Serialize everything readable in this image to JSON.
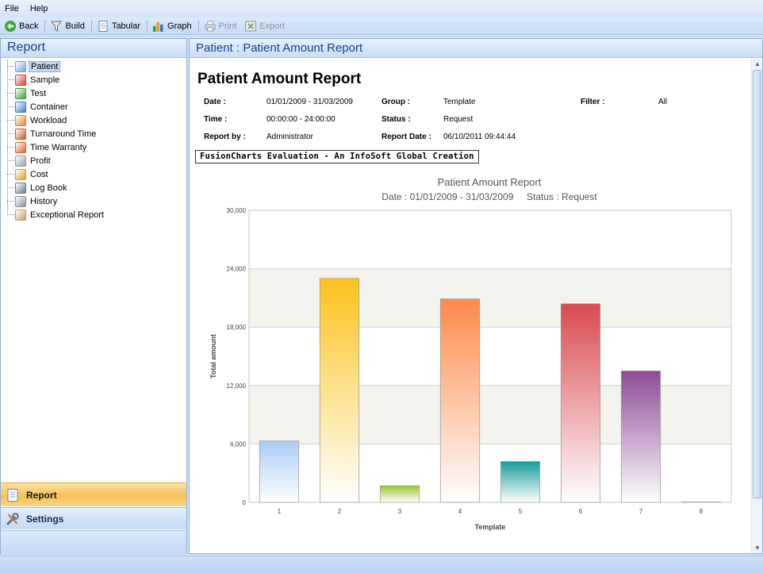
{
  "menubar": {
    "items": [
      "File",
      "Help"
    ]
  },
  "toolbar": {
    "back": "Back",
    "build": "Build",
    "tabular": "Tabular",
    "graph": "Graph",
    "print": "Print",
    "export": "Export"
  },
  "left_pane": {
    "title": "Report",
    "tree": [
      {
        "label": "Patient",
        "icon": "patient-icon",
        "color": "#6fa6d9"
      },
      {
        "label": "Sample",
        "icon": "sample-icon",
        "color": "#d14030"
      },
      {
        "label": "Test",
        "icon": "test-icon",
        "color": "#3aa03a"
      },
      {
        "label": "Container",
        "icon": "container-icon",
        "color": "#3d7fc8"
      },
      {
        "label": "Workload",
        "icon": "workload-icon",
        "color": "#d98b2b"
      },
      {
        "label": "Turnaround Time",
        "icon": "turnaround-clock-icon",
        "color": "#c85a2a"
      },
      {
        "label": "Time Warranty",
        "icon": "warranty-clock-icon",
        "color": "#e06030"
      },
      {
        "label": "Profit",
        "icon": "profit-icon",
        "color": "#9aa0a8"
      },
      {
        "label": "Cost",
        "icon": "cost-coins-icon",
        "color": "#d6a11e"
      },
      {
        "label": "Log Book",
        "icon": "log-book-icon",
        "color": "#6c7c8c"
      },
      {
        "label": "History",
        "icon": "history-icon",
        "color": "#8892a0"
      },
      {
        "label": "Exceptional Report",
        "icon": "exceptional-report-icon",
        "color": "#c0a060"
      }
    ],
    "nav": {
      "report": "Report",
      "settings": "Settings"
    }
  },
  "right_pane": {
    "title": "Patient : Patient Amount Report",
    "report_title": "Patient Amount Report",
    "meta": {
      "date_label": "Date :",
      "date_value": "01/01/2009 - 31/03/2009",
      "time_label": "Time :",
      "time_value": "00:00:00 - 24:00:00",
      "reportby_label": "Report by :",
      "reportby_value": "Administrator",
      "group_label": "Group :",
      "group_value": "Template",
      "status_label": "Status :",
      "status_value": "Request",
      "reportdate_label": "Report Date :",
      "reportdate_value": "06/10/2011 09:44:44",
      "filter_label": "Filter :",
      "filter_value": "All"
    },
    "banner": "FusionCharts Evaluation - An InfoSoft Global Creation"
  },
  "chart_data": {
    "type": "bar",
    "title": "Patient Amount Report",
    "subtitle": "Date : 01/01/2009 - 31/03/2009     Status : Request",
    "xlabel": "Template",
    "ylabel": "Total amount",
    "ylim": [
      0,
      30000
    ],
    "yticks": [
      "0",
      "6,000",
      "12,000",
      "18,000",
      "24,000",
      "30,000"
    ],
    "categories": [
      "1",
      "2",
      "3",
      "4",
      "5",
      "6",
      "7",
      "8"
    ],
    "values": [
      6300,
      23000,
      1700,
      20900,
      4200,
      20400,
      13500,
      0
    ],
    "colors": [
      "#a9cdf5",
      "#fbc21d",
      "#9ac531",
      "#fd8a4a",
      "#1a9c9c",
      "#da4b4f",
      "#8e4a95",
      "#cccccc"
    ],
    "grid": true
  }
}
